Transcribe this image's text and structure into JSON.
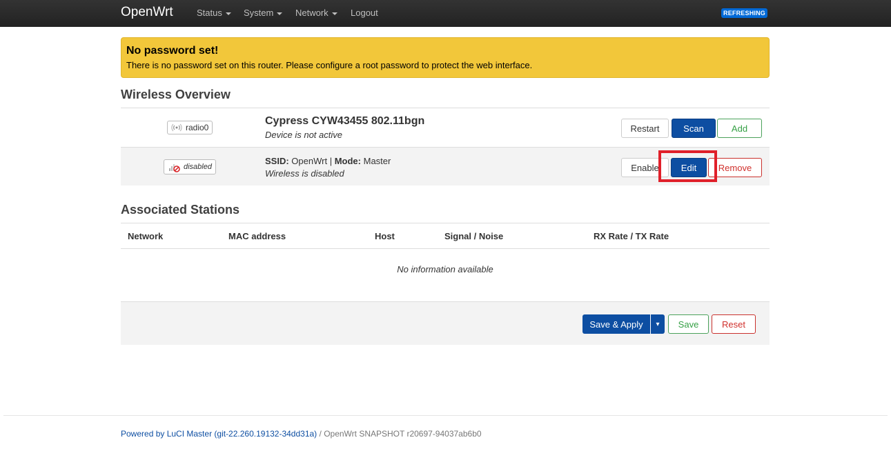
{
  "navbar": {
    "brand": "OpenWrt",
    "menu": [
      {
        "label": "Status",
        "has_dropdown": true
      },
      {
        "label": "System",
        "has_dropdown": true
      },
      {
        "label": "Network",
        "has_dropdown": true
      },
      {
        "label": "Logout",
        "has_dropdown": false
      }
    ],
    "status_badge": "REFRESHING"
  },
  "alert": {
    "title": "No password set!",
    "text": "There is no password set on this router. Please configure a root password to protect the web interface."
  },
  "wireless": {
    "heading": "Wireless Overview",
    "radio": {
      "badge_label": "radio0",
      "badge_icon": "wifi-signal-icon",
      "title": "Cypress CYW43455 802.11bgn",
      "subtitle": "Device is not active",
      "buttons": {
        "restart": "Restart",
        "scan": "Scan",
        "add": "Add"
      }
    },
    "network": {
      "badge_label": "disabled",
      "badge_icon": "wifi-disabled-icon",
      "ssid_label": "SSID:",
      "ssid_value": "OpenWrt",
      "separator": "|",
      "mode_label": "Mode:",
      "mode_value": "Master",
      "status": "Wireless is disabled",
      "buttons": {
        "enable": "Enable",
        "edit": "Edit",
        "remove": "Remove"
      }
    }
  },
  "stations": {
    "heading": "Associated Stations",
    "columns": [
      "Network",
      "MAC address",
      "Host",
      "Signal / Noise",
      "RX Rate / TX Rate"
    ],
    "empty_text": "No information available"
  },
  "actions": {
    "save_apply": "Save & Apply",
    "dropdown_glyph": "▾",
    "save": "Save",
    "reset": "Reset"
  },
  "footer": {
    "link_text": "Powered by LuCI Master (git-22.260.19132-34dd31a)",
    "rest_text": " / OpenWrt SNAPSHOT r20697-94037ab6b0"
  },
  "colors": {
    "navbar": "#222222",
    "alert_bg": "#f2c73a",
    "primary": "#0d4ea2",
    "positive": "#35a045",
    "negative": "#d0302c",
    "highlight": "#e0202a"
  }
}
